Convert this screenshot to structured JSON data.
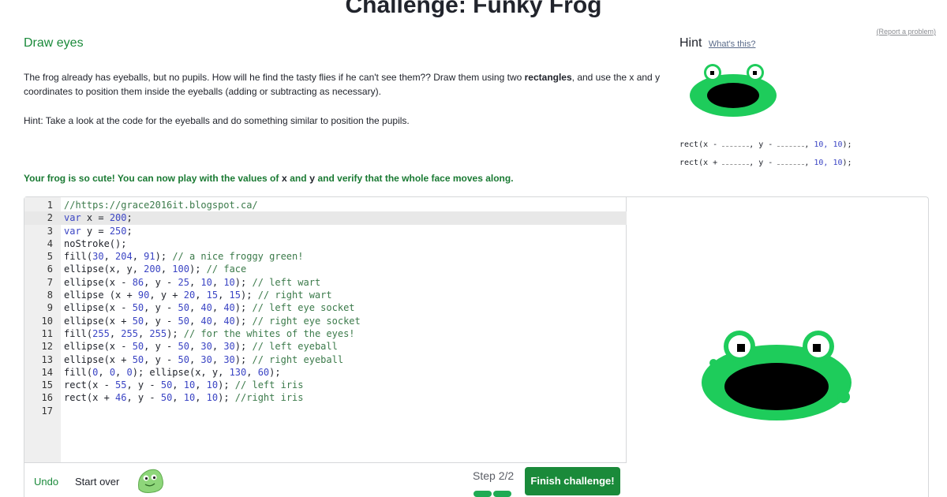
{
  "page": {
    "title": "Challenge: Funky Frog",
    "report_link": "(Report a problem)"
  },
  "step": {
    "title": "Draw eyes",
    "paragraph1_a": "The frog already has eyeballs, but no pupils. How will he find the tasty flies if he can't see them?? Draw them using two ",
    "paragraph1_link": "rectangles",
    "paragraph1_b": ", and use the x and y coordinates to position them inside the eyeballs (adding or subtracting as necessary).",
    "paragraph2": "Hint: Take a look at the code for the eyeballs and do something similar to position the pupils.",
    "success_a": "Your frog is so cute! You can now play with the values of ",
    "success_x": "x",
    "success_and": " and ",
    "success_y": "y",
    "success_b": " and verify that the whole face moves along."
  },
  "hint": {
    "heading": "Hint",
    "whats_this": "What's this?",
    "code_line1": {
      "prefix": "rect(x - ",
      "mid": ", y - ",
      "suffix_num": "10, 10",
      "suffix": ");"
    },
    "code_line2": {
      "prefix": "rect(x + ",
      "mid": ", y - ",
      "suffix_num": "10, 10",
      "suffix": ");"
    }
  },
  "editor": {
    "active_line": 2,
    "lines": [
      "//https://grace2016it.blogspot.ca/",
      "var x = 200;",
      "var y = 250;",
      "noStroke();",
      "fill(30, 204, 91); // a nice froggy green!",
      "ellipse(x, y, 200, 100); // face",
      "ellipse(x - 86, y - 25, 10, 10); // left wart",
      "ellipse (x + 90, y + 20, 15, 15); // right wart",
      "ellipse(x - 50, y - 50, 40, 40); // left eye socket",
      "ellipse(x + 50, y - 50, 40, 40); // right eye socket",
      "fill(255, 255, 255); // for the whites of the eyes!",
      "ellipse(x - 50, y - 50, 30, 30); // left eyeball",
      "ellipse(x + 50, y - 50, 30, 30); // right eyeball",
      "fill(0, 0, 0); ellipse(x, y, 130, 60);",
      "rect(x - 55, y - 50, 10, 10); // left iris",
      "rect(x + 46, y - 50, 10, 10); //right iris",
      ""
    ]
  },
  "footer": {
    "undo": "Undo",
    "start_over": "Start over",
    "step_label": "Step 2/2",
    "finish": "Finish challenge!"
  },
  "colors": {
    "accent_green": "#1a8a3a",
    "frog_green": "#1ecc5b",
    "keyword_blue": "#3b45c4",
    "comment_green": "#3b7a4a"
  },
  "icons": {
    "avatar": "green-blob-avatar-icon"
  }
}
